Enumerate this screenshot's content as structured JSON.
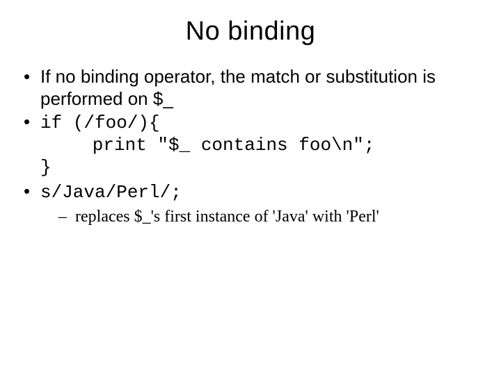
{
  "title": "No binding",
  "bullets": {
    "b1": "If no binding operator, the match or substitution is performed on $_",
    "b2_line1": "if (/foo/){",
    "b2_line2": "   print \"$_ contains foo\\n\";",
    "b2_line3": "}",
    "b3": "s/Java/Perl/;",
    "b3_sub": "replaces $_'s first instance of 'Java' with 'Perl'"
  }
}
